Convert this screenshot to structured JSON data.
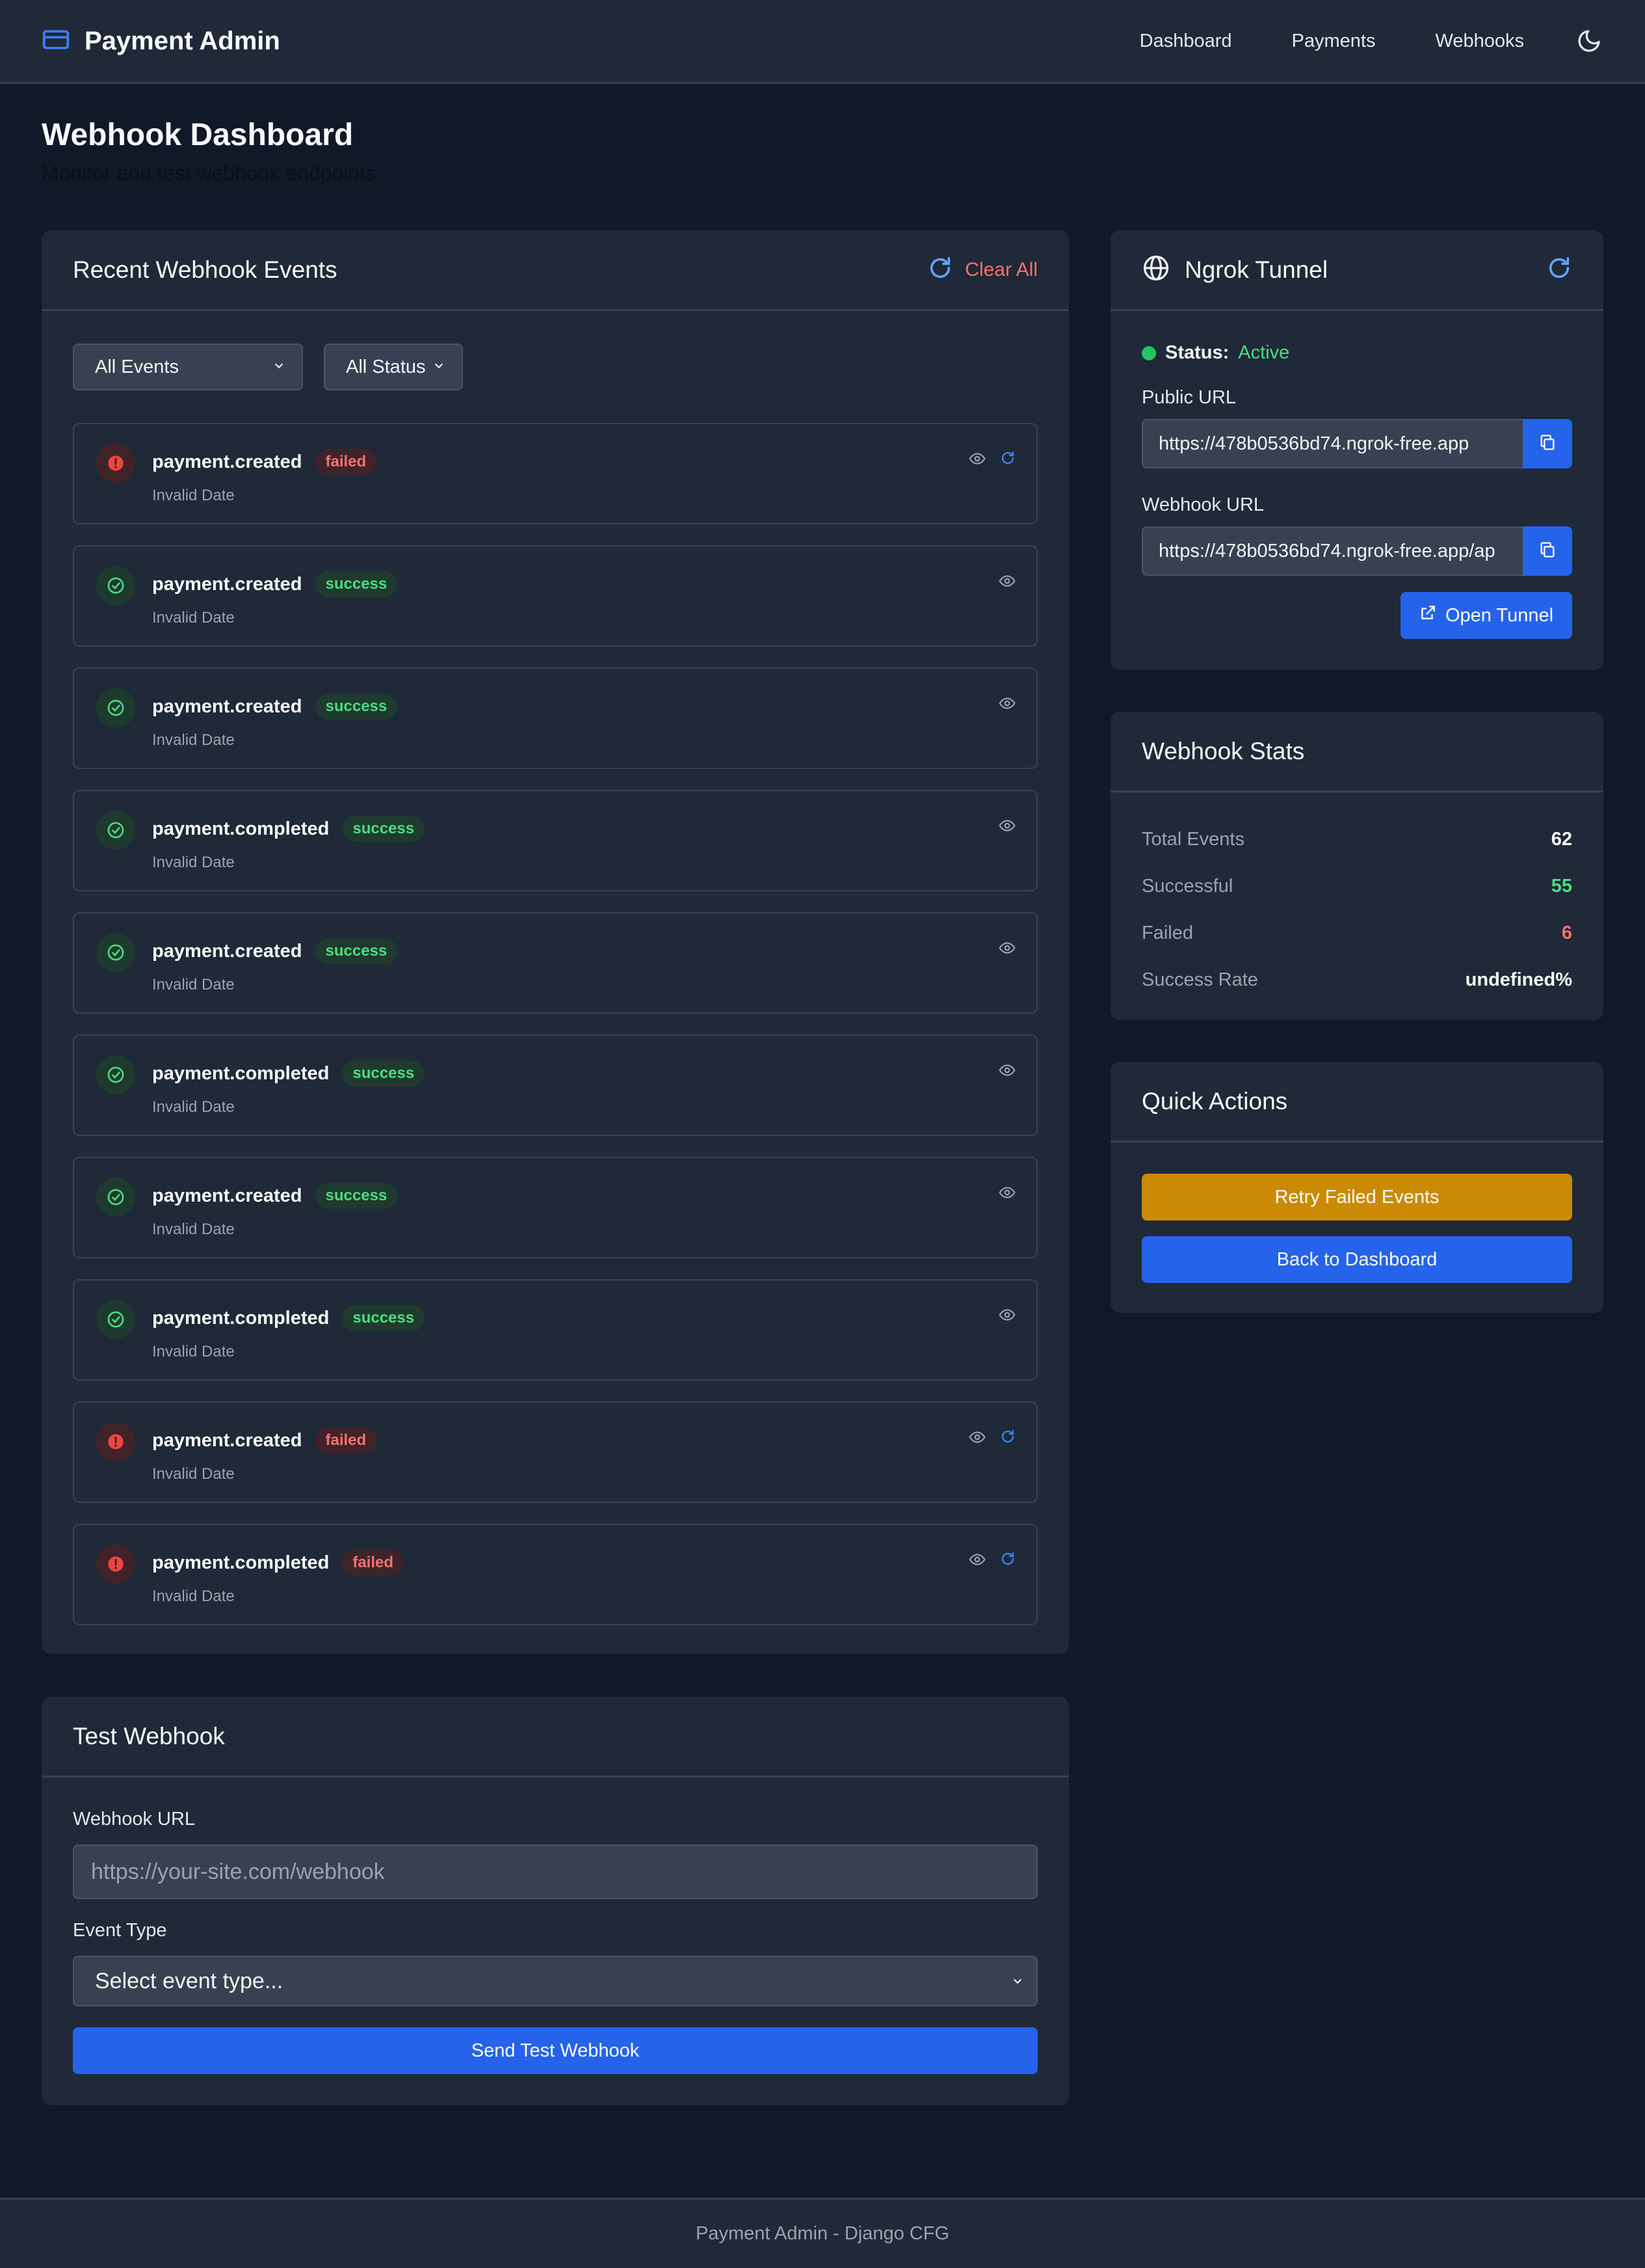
{
  "header": {
    "brand": "Payment Admin",
    "nav": [
      "Dashboard",
      "Payments",
      "Webhooks"
    ],
    "theme_icon": "moon-icon"
  },
  "page": {
    "title": "Webhook Dashboard",
    "subtitle": "Monitor and test webhook endpoints"
  },
  "events": {
    "title": "Recent Webhook Events",
    "clear_all": "Clear All",
    "filter_event": "All Events",
    "filter_status": "All Status",
    "items": [
      {
        "name": "payment.created",
        "status": "failed",
        "date": "Invalid Date"
      },
      {
        "name": "payment.created",
        "status": "success",
        "date": "Invalid Date"
      },
      {
        "name": "payment.created",
        "status": "success",
        "date": "Invalid Date"
      },
      {
        "name": "payment.completed",
        "status": "success",
        "date": "Invalid Date"
      },
      {
        "name": "payment.created",
        "status": "success",
        "date": "Invalid Date"
      },
      {
        "name": "payment.completed",
        "status": "success",
        "date": "Invalid Date"
      },
      {
        "name": "payment.created",
        "status": "success",
        "date": "Invalid Date"
      },
      {
        "name": "payment.completed",
        "status": "success",
        "date": "Invalid Date"
      },
      {
        "name": "payment.created",
        "status": "failed",
        "date": "Invalid Date"
      },
      {
        "name": "payment.completed",
        "status": "failed",
        "date": "Invalid Date"
      }
    ]
  },
  "test_webhook": {
    "title": "Test Webhook",
    "url_label": "Webhook URL",
    "url_placeholder": "https://your-site.com/webhook",
    "event_label": "Event Type",
    "event_placeholder": "Select event type...",
    "send": "Send Test Webhook"
  },
  "ngrok": {
    "title": "Ngrok Tunnel",
    "status_label": "Status:",
    "status_value": "Active",
    "public_url_label": "Public URL",
    "public_url": "https://478b0536bd74.ngrok-free.app",
    "webhook_url_label": "Webhook URL",
    "webhook_url": "https://478b0536bd74.ngrok-free.app/ap",
    "open_tunnel": "Open Tunnel"
  },
  "stats": {
    "title": "Webhook Stats",
    "rows": [
      {
        "label": "Total Events",
        "value": "62"
      },
      {
        "label": "Successful",
        "value": "55"
      },
      {
        "label": "Failed",
        "value": "6"
      },
      {
        "label": "Success Rate",
        "value": "undefined%"
      }
    ]
  },
  "quick_actions": {
    "title": "Quick Actions",
    "retry": "Retry Failed Events",
    "back": "Back to Dashboard"
  },
  "footer": "Payment Admin - Django CFG",
  "colors": {
    "background": "#111827",
    "card": "#1f2937",
    "accent": "#2563eb",
    "success": "#4ade80",
    "danger": "#f87171",
    "warning": "#ca8a04"
  }
}
